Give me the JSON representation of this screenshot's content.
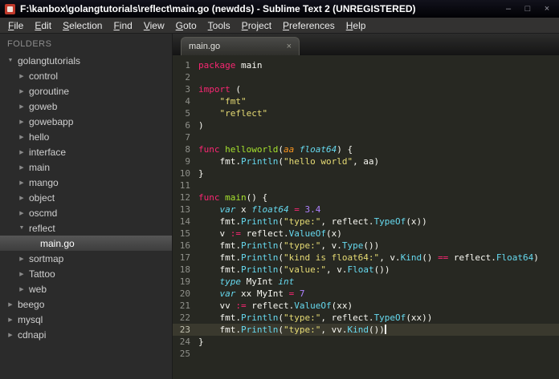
{
  "window": {
    "title": "F:\\kanbox\\golangtutorials\\reflect\\main.go (newdds) - Sublime Text 2 (UNREGISTERED)",
    "controls": {
      "minimize": "–",
      "maximize": "□",
      "close": "×"
    }
  },
  "menu": {
    "items": [
      "File",
      "Edit",
      "Selection",
      "Find",
      "View",
      "Goto",
      "Tools",
      "Project",
      "Preferences",
      "Help"
    ]
  },
  "sidebar": {
    "header": "FOLDERS",
    "items": [
      {
        "label": "golangtutorials",
        "level": 0,
        "type": "folder",
        "expanded": true,
        "selected": false
      },
      {
        "label": "control",
        "level": 1,
        "type": "folder",
        "expanded": false,
        "selected": false
      },
      {
        "label": "goroutine",
        "level": 1,
        "type": "folder",
        "expanded": false,
        "selected": false
      },
      {
        "label": "goweb",
        "level": 1,
        "type": "folder",
        "expanded": false,
        "selected": false
      },
      {
        "label": "gowebapp",
        "level": 1,
        "type": "folder",
        "expanded": false,
        "selected": false
      },
      {
        "label": "hello",
        "level": 1,
        "type": "folder",
        "expanded": false,
        "selected": false
      },
      {
        "label": "interface",
        "level": 1,
        "type": "folder",
        "expanded": false,
        "selected": false
      },
      {
        "label": "main",
        "level": 1,
        "type": "folder",
        "expanded": false,
        "selected": false
      },
      {
        "label": "mango",
        "level": 1,
        "type": "folder",
        "expanded": false,
        "selected": false
      },
      {
        "label": "object",
        "level": 1,
        "type": "folder",
        "expanded": false,
        "selected": false
      },
      {
        "label": "oscmd",
        "level": 1,
        "type": "folder",
        "expanded": false,
        "selected": false
      },
      {
        "label": "reflect",
        "level": 1,
        "type": "folder",
        "expanded": true,
        "selected": false
      },
      {
        "label": "main.go",
        "level": 2,
        "type": "file",
        "expanded": false,
        "selected": true
      },
      {
        "label": "sortmap",
        "level": 1,
        "type": "folder",
        "expanded": false,
        "selected": false
      },
      {
        "label": "Tattoo",
        "level": 1,
        "type": "folder",
        "expanded": false,
        "selected": false
      },
      {
        "label": "web",
        "level": 1,
        "type": "folder",
        "expanded": false,
        "selected": false
      },
      {
        "label": "beego",
        "level": 0,
        "type": "folder",
        "expanded": false,
        "selected": false
      },
      {
        "label": "mysql",
        "level": 0,
        "type": "folder",
        "expanded": false,
        "selected": false
      },
      {
        "label": "cdnapi",
        "level": 0,
        "type": "folder",
        "expanded": false,
        "selected": false
      }
    ]
  },
  "tab": {
    "label": "main.go",
    "close": "×"
  },
  "editor": {
    "active_line": 23,
    "lines": [
      {
        "num": 1,
        "tokens": [
          [
            "k",
            "package"
          ],
          [
            "p",
            " main"
          ]
        ]
      },
      {
        "num": 2,
        "tokens": []
      },
      {
        "num": 3,
        "tokens": [
          [
            "k",
            "import"
          ],
          [
            "p",
            " ("
          ]
        ]
      },
      {
        "num": 4,
        "tokens": [
          [
            "p",
            "    "
          ],
          [
            "s",
            "\"fmt\""
          ]
        ]
      },
      {
        "num": 5,
        "tokens": [
          [
            "p",
            "    "
          ],
          [
            "s",
            "\"reflect\""
          ]
        ]
      },
      {
        "num": 6,
        "tokens": [
          [
            "p",
            ")"
          ]
        ]
      },
      {
        "num": 7,
        "tokens": []
      },
      {
        "num": 8,
        "tokens": [
          [
            "k",
            "func "
          ],
          [
            "f",
            "helloworld"
          ],
          [
            "p",
            "("
          ],
          [
            "a",
            "aa"
          ],
          [
            "p",
            " "
          ],
          [
            "t",
            "float64"
          ],
          [
            "p",
            ") {"
          ]
        ]
      },
      {
        "num": 9,
        "tokens": [
          [
            "p",
            "    fmt."
          ],
          [
            "c",
            "Println"
          ],
          [
            "p",
            "("
          ],
          [
            "s",
            "\"hello world\""
          ],
          [
            "p",
            ", aa)"
          ]
        ]
      },
      {
        "num": 10,
        "tokens": [
          [
            "p",
            "}"
          ]
        ]
      },
      {
        "num": 11,
        "tokens": []
      },
      {
        "num": 12,
        "tokens": [
          [
            "k",
            "func "
          ],
          [
            "f",
            "main"
          ],
          [
            "p",
            "() {"
          ]
        ]
      },
      {
        "num": 13,
        "tokens": [
          [
            "p",
            "    "
          ],
          [
            "t",
            "var"
          ],
          [
            "p",
            " x "
          ],
          [
            "t",
            "float64"
          ],
          [
            "p",
            " "
          ],
          [
            "k",
            "="
          ],
          [
            "p",
            " "
          ],
          [
            "n",
            "3.4"
          ]
        ]
      },
      {
        "num": 14,
        "tokens": [
          [
            "p",
            "    fmt."
          ],
          [
            "c",
            "Println"
          ],
          [
            "p",
            "("
          ],
          [
            "s",
            "\"type:\""
          ],
          [
            "p",
            ", reflect."
          ],
          [
            "c",
            "TypeOf"
          ],
          [
            "p",
            "(x))"
          ]
        ]
      },
      {
        "num": 15,
        "tokens": [
          [
            "p",
            "    v "
          ],
          [
            "k",
            ":="
          ],
          [
            "p",
            " reflect."
          ],
          [
            "c",
            "ValueOf"
          ],
          [
            "p",
            "(x)"
          ]
        ]
      },
      {
        "num": 16,
        "tokens": [
          [
            "p",
            "    fmt."
          ],
          [
            "c",
            "Println"
          ],
          [
            "p",
            "("
          ],
          [
            "s",
            "\"type:\""
          ],
          [
            "p",
            ", v."
          ],
          [
            "c",
            "Type"
          ],
          [
            "p",
            "())"
          ]
        ]
      },
      {
        "num": 17,
        "tokens": [
          [
            "p",
            "    fmt."
          ],
          [
            "c",
            "Println"
          ],
          [
            "p",
            "("
          ],
          [
            "s",
            "\"kind is float64:\""
          ],
          [
            "p",
            ", v."
          ],
          [
            "c",
            "Kind"
          ],
          [
            "p",
            "() "
          ],
          [
            "k",
            "=="
          ],
          [
            "p",
            " reflect."
          ],
          [
            "c",
            "Float64"
          ],
          [
            "p",
            ")"
          ]
        ]
      },
      {
        "num": 18,
        "tokens": [
          [
            "p",
            "    fmt."
          ],
          [
            "c",
            "Println"
          ],
          [
            "p",
            "("
          ],
          [
            "s",
            "\"value:\""
          ],
          [
            "p",
            ", v."
          ],
          [
            "c",
            "Float"
          ],
          [
            "p",
            "())"
          ]
        ]
      },
      {
        "num": 19,
        "tokens": [
          [
            "p",
            "    "
          ],
          [
            "t",
            "type"
          ],
          [
            "p",
            " MyInt "
          ],
          [
            "t",
            "int"
          ]
        ]
      },
      {
        "num": 20,
        "tokens": [
          [
            "p",
            "    "
          ],
          [
            "t",
            "var"
          ],
          [
            "p",
            " xx MyInt "
          ],
          [
            "k",
            "="
          ],
          [
            "p",
            " "
          ],
          [
            "n",
            "7"
          ]
        ]
      },
      {
        "num": 21,
        "tokens": [
          [
            "p",
            "    vv "
          ],
          [
            "k",
            ":="
          ],
          [
            "p",
            " reflect."
          ],
          [
            "c",
            "ValueOf"
          ],
          [
            "p",
            "(xx)"
          ]
        ]
      },
      {
        "num": 22,
        "tokens": [
          [
            "p",
            "    fmt."
          ],
          [
            "c",
            "Println"
          ],
          [
            "p",
            "("
          ],
          [
            "s",
            "\"type:\""
          ],
          [
            "p",
            ", reflect."
          ],
          [
            "c",
            "TypeOf"
          ],
          [
            "p",
            "(xx))"
          ]
        ]
      },
      {
        "num": 23,
        "tokens": [
          [
            "p",
            "    fmt."
          ],
          [
            "c",
            "Println"
          ],
          [
            "p",
            "("
          ],
          [
            "s",
            "\"type:\""
          ],
          [
            "p",
            ", vv."
          ],
          [
            "c",
            "Kind"
          ],
          [
            "p",
            "())"
          ]
        ]
      },
      {
        "num": 24,
        "tokens": [
          [
            "p",
            "}"
          ]
        ]
      },
      {
        "num": 25,
        "tokens": []
      }
    ]
  },
  "colors": {
    "editor_bg": "#272822",
    "sidebar_bg": "#2b2b2b",
    "keyword_pink": "#F92672",
    "type_cyan": "#66D9EF",
    "function_green": "#A6E22E",
    "string_yellow": "#E6DB74",
    "number_purple": "#AE81FF",
    "param_orange": "#FD971F",
    "plain_text": "#F8F8F2",
    "line_number": "#8F908A"
  }
}
